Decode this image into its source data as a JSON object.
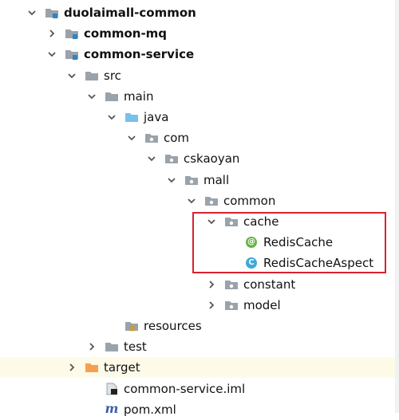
{
  "colors": {
    "folder_gray": "#9aa3ab",
    "folder_blue": "#79c1e8",
    "module_blue": "#2f84c4",
    "excluded_orange": "#f5a051",
    "annotation_green": "#62b543",
    "class_blue": "#40a8d8",
    "highlight_box": "#d8222e"
  },
  "tree": [
    {
      "label": "duolaimall-common",
      "depth": 0,
      "arrow": "down",
      "icon": "module-folder-icon",
      "bold": true
    },
    {
      "label": "common-mq",
      "depth": 1,
      "arrow": "right",
      "icon": "module-folder-icon",
      "bold": true
    },
    {
      "label": "common-service",
      "depth": 1,
      "arrow": "down",
      "icon": "module-folder-icon",
      "bold": true
    },
    {
      "label": "src",
      "depth": 2,
      "arrow": "down",
      "icon": "folder-icon"
    },
    {
      "label": "main",
      "depth": 3,
      "arrow": "down",
      "icon": "folder-icon"
    },
    {
      "label": "java",
      "depth": 4,
      "arrow": "down",
      "icon": "source-folder-icon"
    },
    {
      "label": "com",
      "depth": 5,
      "arrow": "down",
      "icon": "package-icon"
    },
    {
      "label": "cskaoyan",
      "depth": 6,
      "arrow": "down",
      "icon": "package-icon"
    },
    {
      "label": "mall",
      "depth": 7,
      "arrow": "down",
      "icon": "package-icon"
    },
    {
      "label": "common",
      "depth": 8,
      "arrow": "down",
      "icon": "package-icon"
    },
    {
      "label": "cache",
      "depth": 9,
      "arrow": "down",
      "icon": "package-icon"
    },
    {
      "label": "RedisCache",
      "depth": 10,
      "arrow": "none",
      "icon": "annotation-icon",
      "letter": "@"
    },
    {
      "label": "RedisCacheAspect",
      "depth": 10,
      "arrow": "none",
      "icon": "class-icon",
      "letter": "C"
    },
    {
      "label": "constant",
      "depth": 9,
      "arrow": "right",
      "icon": "package-icon"
    },
    {
      "label": "model",
      "depth": 9,
      "arrow": "right",
      "icon": "package-icon"
    },
    {
      "label": "resources",
      "depth": 4,
      "arrow": "none",
      "icon": "resources-folder-icon"
    },
    {
      "label": "test",
      "depth": 3,
      "arrow": "right",
      "icon": "folder-icon"
    },
    {
      "label": "target",
      "depth": 2,
      "arrow": "right",
      "icon": "excluded-folder-icon",
      "highlight": true
    },
    {
      "label": "common-service.iml",
      "depth": 3,
      "arrow": "none",
      "icon": "iml-file-icon"
    },
    {
      "label": "pom.xml",
      "depth": 3,
      "arrow": "none",
      "icon": "maven-file-icon",
      "letter": "m"
    }
  ]
}
